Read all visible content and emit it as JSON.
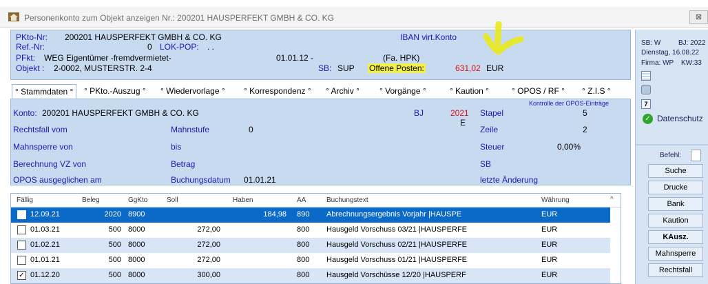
{
  "window": {
    "title": "Personenkonto zum Objekt anzeigen  Nr.: 200201 HAUSPERFEKT GMBH & CO. KG",
    "close_label": "⊠"
  },
  "header": {
    "pkto_label": "PKto-Nr:",
    "pkto_value": "200201  HAUSPERFEKT GMBH & CO. KG",
    "iban_label": "IBAN virt.Konto",
    "ref_label": "Ref.-Nr:",
    "ref_value": "0",
    "lokpop_label": "LOK-POP:",
    "lokpop_value": ".   .",
    "pfkt_label": "PFkt:",
    "pfkt_value": "WEG Eigentümer -fremdvermietet-",
    "pfkt_date": "01.01.12  -",
    "pfkt_firma": "(Fa. HPK)",
    "objekt_label": "Objekt :",
    "objekt_value": "2-0002, MUSTERSTR. 2-4",
    "sb_label": "SB:",
    "sb_value": "SUP",
    "offene_label": "Offene Posten:",
    "offene_value": "631,02",
    "offene_currency": "EUR"
  },
  "right_panel": {
    "sb": "SB:  W",
    "bj": "BJ: 2022",
    "date": "Dienstag, 16.08.22",
    "firma": "Firma: WP",
    "kw": "KW:33",
    "datenschutz": "Datenschutz",
    "calendar_number": "7",
    "befehl_label": "Befehl:",
    "buttons": [
      "Suche",
      "Drucke",
      "Bank",
      "Kaution",
      "KAusz.",
      "Mahnsperre",
      "Rechtsfall"
    ]
  },
  "tabs": [
    "° Stammdaten °",
    "° PKto.-Auszug °",
    "° Wiedervorlage °",
    "° Korrespondenz °",
    "° Archiv °",
    "° Vorgänge °",
    "° Kaution °",
    "° OPOS / RF °",
    "° Z.I.S °"
  ],
  "stammdaten": {
    "konto_label": "Konto:",
    "konto_value": "200201 HAUSPERFEKT GMBH & CO. KG",
    "bj_label": "BJ",
    "bj_value": "2021",
    "bj_flag": "E",
    "stapel_label": "Stapel",
    "stapel_value": "5",
    "opos_legend": "Kontrolle der OPOS-Einträge",
    "rechtsfall_label": "Rechtsfall vom",
    "mahnstufe_label": "Mahnstufe",
    "mahnstufe_value": "0",
    "zeile_label": "Zeile",
    "zeile_value": "2",
    "mahnsperre_label": "Mahnsperre von",
    "bis_label": "bis",
    "steuer_label": "Steuer",
    "steuer_value": "0,00%",
    "berechnung_label": "Berechnung VZ von",
    "betrag_label": "Betrag",
    "sb_label": "SB",
    "opos_label": "OPOS ausgeglichen am",
    "buchungsdatum_label": "Buchungsdatum",
    "buchungsdatum_value": "01.01.21",
    "letzte_label": "letzte Änderung"
  },
  "grid": {
    "columns": [
      "Fällig",
      "Beleg",
      "GgKto",
      "Soll",
      "Haben",
      "AA",
      "Buchungstext",
      "Währung"
    ],
    "rows": [
      {
        "checked": "",
        "faellig": "12.09.21",
        "beleg": "2020",
        "ggkto": "8900",
        "soll": "",
        "haben": "184,98",
        "aa": "890",
        "text": "Abrechnungsergebnis Vorjahr |HAUSPE",
        "waehrung": "EUR"
      },
      {
        "checked": "",
        "faellig": "01.03.21",
        "beleg": "500",
        "ggkto": "8000",
        "soll": "272,00",
        "haben": "",
        "aa": "800",
        "text": "Hausgeld Vorschuss 03/21 |HAUSPERFE",
        "waehrung": "EUR"
      },
      {
        "checked": "",
        "faellig": "01.02.21",
        "beleg": "500",
        "ggkto": "8000",
        "soll": "272,00",
        "haben": "",
        "aa": "800",
        "text": "Hausgeld Vorschuss 02/21 |HAUSPERFE",
        "waehrung": "EUR"
      },
      {
        "checked": "",
        "faellig": "01.01.21",
        "beleg": "500",
        "ggkto": "8000",
        "soll": "272,00",
        "haben": "",
        "aa": "800",
        "text": "Hausgeld Vorschuss 01/21 |HAUSPERFE",
        "waehrung": "EUR"
      },
      {
        "checked": "✓",
        "faellig": "01.12.20",
        "beleg": "500",
        "ggkto": "8000",
        "soll": "300,00",
        "haben": "",
        "aa": "800",
        "text": "Hausgeld Vorschüsse 12/20 |HAUSPERF",
        "waehrung": "EUR"
      }
    ]
  }
}
